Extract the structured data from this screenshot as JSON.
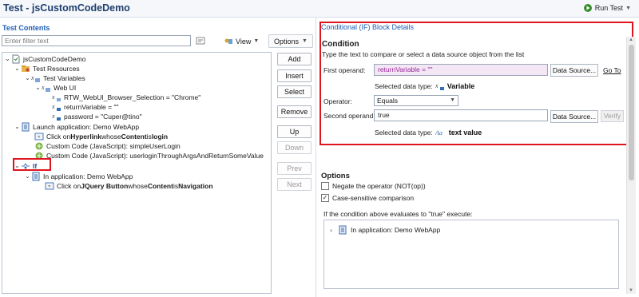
{
  "title": "Test - jsCustomCodeDemo",
  "run_test": "Run Test",
  "left": {
    "section_title": "Test Contents",
    "filter_placeholder": "Enter filter text",
    "view_label": "View",
    "options_label": "Options",
    "tree": [
      {
        "text": "jsCustomCodeDemo"
      },
      {
        "text": "Test Resources"
      },
      {
        "text": "Test Variables"
      },
      {
        "text": "Web UI"
      },
      {
        "text": "RTW_WebUI_Browser_Selection = \"Chrome\""
      },
      {
        "text": "returnVariable = \"\""
      },
      {
        "text": "password = \"Cuper@tino\""
      },
      {
        "text": "Launch application: Demo WebApp"
      },
      {
        "pre": "Click on ",
        "b1": "Hyperlink",
        "mid": " whose ",
        "b2": "Content",
        "mid2": " is ",
        "b3": "login"
      },
      {
        "text": "Custom Code (JavaScript): simpleUserLogin"
      },
      {
        "text": "Custom Code (JavaScript): userloginThroughArgsAndReturnSomeValue"
      },
      {
        "text": "If"
      },
      {
        "text": "In application: Demo WebApp"
      },
      {
        "pre": "Click on ",
        "b1": "JQuery Button",
        "mid": " whose ",
        "b2": "Content",
        "mid2": " is ",
        "b3": "Navigation"
      }
    ],
    "buttons": {
      "add": "Add",
      "insert": "Insert",
      "select": "Select",
      "remove": "Remove",
      "up": "Up",
      "down": "Down",
      "prev": "Prev",
      "next": "Next"
    }
  },
  "right": {
    "section_title": "Conditional (IF) Block Details",
    "condition_title": "Condition",
    "condition_desc": "Type the text to compare or select a data source object from the list",
    "first_operand_label": "First operand:",
    "first_operand_value": "returnVariable = \"\"",
    "data_source_label": "Data Source...",
    "goto_label": "Go To",
    "selected_type_label": "Selected data type:",
    "first_type": "Variable",
    "operator_label": "Operator:",
    "operator_value": "Equals",
    "second_operand_label": "Second operand:",
    "second_operand_value": "true",
    "verify_label": "Verify",
    "second_type": "text value",
    "options_title": "Options",
    "negate_label": "Negate the operator (NOT(op))",
    "negate_checked": false,
    "case_label": "Case-sensitive comparison",
    "case_checked": true,
    "if_exec_label": "If the condition above evaluates to \"true\" execute:",
    "exec_item": "In application: Demo WebApp"
  },
  "colors": {
    "highlight": "#e0141e",
    "link_blue": "#1d5eb6",
    "variable_purple": "#9b2a9b"
  }
}
